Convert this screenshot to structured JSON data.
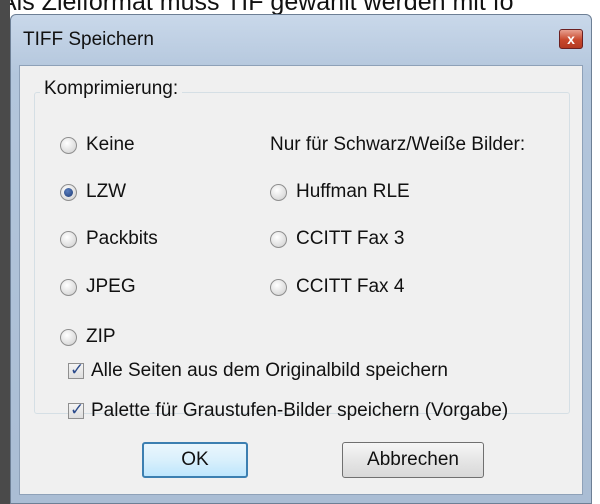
{
  "background_text": "Als Zielformat muss TIF gewählt werden mit fo",
  "dialog": {
    "title": "TIFF Speichern",
    "close_glyph": "x",
    "group_label": "Komprimierung:",
    "mono_label": "Nur für Schwarz/Weiße Bilder:",
    "compression_options": [
      "Keine",
      "LZW",
      "Packbits",
      "JPEG",
      "ZIP"
    ],
    "mono_options": [
      "Huffman RLE",
      "CCITT Fax 3",
      "CCITT Fax 4"
    ],
    "selected_option": "LZW",
    "checkboxes": [
      {
        "label": "Alle Seiten aus dem Originalbild speichern",
        "checked": true
      },
      {
        "label": "Palette für Graustufen-Bilder speichern (Vorgabe)",
        "checked": true
      }
    ],
    "ok_label": "OK",
    "cancel_label": "Abbrechen"
  }
}
